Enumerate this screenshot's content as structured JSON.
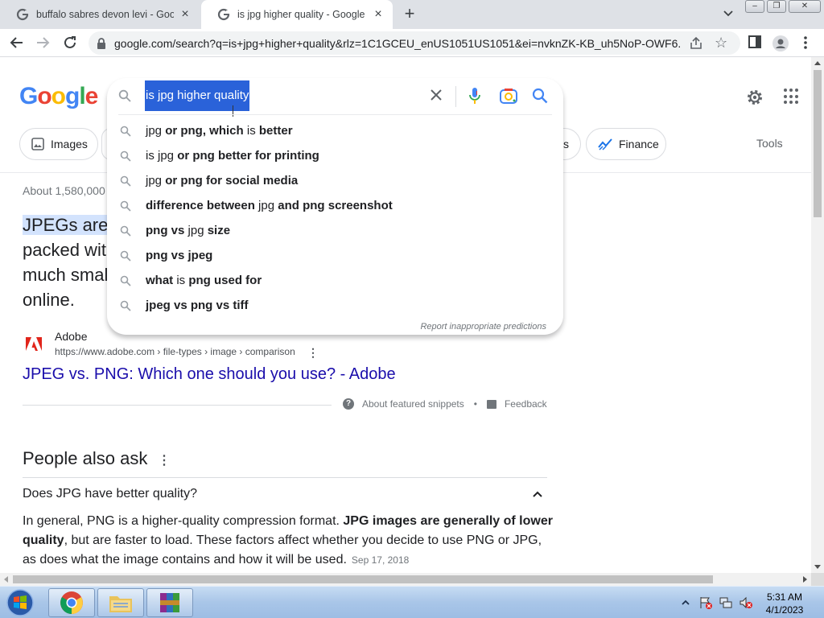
{
  "browser": {
    "tabs": [
      {
        "title": "buffalo sabres devon levi - Googl",
        "active": false
      },
      {
        "title": "is jpg higher quality - Google Sea",
        "active": true
      }
    ],
    "url": "google.com/search?q=is+jpg+higher+quality&rlz=1C1GCEU_enUS1051US1051&ei=nvknZK-KB_uh5NoP-OWF6..."
  },
  "google": {
    "logo_letters": [
      "G",
      "o",
      "o",
      "g",
      "l",
      "e"
    ],
    "logo_colors": [
      "#4285f4",
      "#ea4335",
      "#fbbc05",
      "#4285f4",
      "#34a853",
      "#ea4335"
    ],
    "search_query": "is jpg higher quality",
    "chips": {
      "images": "Images",
      "partial": "s",
      "finance": "Finance"
    },
    "tools": "Tools"
  },
  "suggestions": {
    "items": [
      [
        {
          "t": "jpg ",
          "b": false
        },
        {
          "t": "or png, which ",
          "b": true
        },
        {
          "t": "is ",
          "b": false
        },
        {
          "t": "better",
          "b": true
        }
      ],
      [
        {
          "t": "is jpg ",
          "b": false
        },
        {
          "t": "or png better for printing",
          "b": true
        }
      ],
      [
        {
          "t": "jpg ",
          "b": false
        },
        {
          "t": "or png for social media",
          "b": true
        }
      ],
      [
        {
          "t": "difference between ",
          "b": true
        },
        {
          "t": "jpg ",
          "b": false
        },
        {
          "t": "and png screenshot",
          "b": true
        }
      ],
      [
        {
          "t": "png vs ",
          "b": true
        },
        {
          "t": "jpg ",
          "b": false
        },
        {
          "t": "size",
          "b": true
        }
      ],
      [
        {
          "t": "png vs jpeg",
          "b": true
        }
      ],
      [
        {
          "t": "what ",
          "b": true
        },
        {
          "t": "is ",
          "b": false
        },
        {
          "t": "png used for",
          "b": true
        }
      ],
      [
        {
          "t": "jpeg vs png vs tiff",
          "b": true
        }
      ]
    ],
    "report_link": "Report inappropriate predictions"
  },
  "results": {
    "about": "About 1,580,000",
    "snippet_lines": [
      "JPEGs are",
      "packed wit",
      "much smal",
      "online."
    ],
    "source": {
      "name": "Adobe",
      "url": "https://www.adobe.com › file-types › image › comparison"
    },
    "result_link": "JPEG vs. PNG: Which one should you use? - Adobe",
    "about_snippets": "About featured snippets",
    "feedback": "Feedback",
    "people_also_ask": {
      "title": "People also ask",
      "question": "Does JPG have better quality?",
      "answer_part1": "In general, PNG is a higher-quality compression format. ",
      "answer_bold": "JPG images are generally of lower quality",
      "answer_part2": ", but are faster to load. These factors affect whether you decide to use PNG or JPG, as does what the image contains and how it will be used.",
      "date": "Sep 17, 2018"
    }
  },
  "taskbar": {
    "time": "5:31 AM",
    "date": "4/1/2023"
  }
}
